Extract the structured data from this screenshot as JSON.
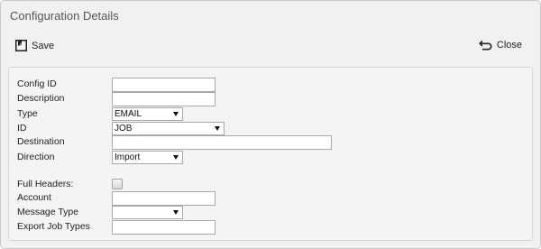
{
  "dialog": {
    "title": "Configuration Details"
  },
  "toolbar": {
    "save_label": "Save",
    "close_label": "Close"
  },
  "form": {
    "config_id": {
      "label": "Config ID",
      "value": ""
    },
    "description": {
      "label": "Description",
      "value": ""
    },
    "type": {
      "label": "Type",
      "value": "EMAIL"
    },
    "id": {
      "label": "ID",
      "value": "JOB"
    },
    "destination": {
      "label": "Destination",
      "value": ""
    },
    "direction": {
      "label": "Direction",
      "value": "Import"
    },
    "full_headers": {
      "label": "Full Headers:",
      "checked": false
    },
    "account": {
      "label": "Account",
      "value": ""
    },
    "message_type": {
      "label": "Message Type",
      "value": ""
    },
    "export_job_types": {
      "label": "Export Job Types",
      "value": ""
    }
  },
  "icons": {
    "save": "save-icon",
    "close": "undo-arrow-icon"
  }
}
